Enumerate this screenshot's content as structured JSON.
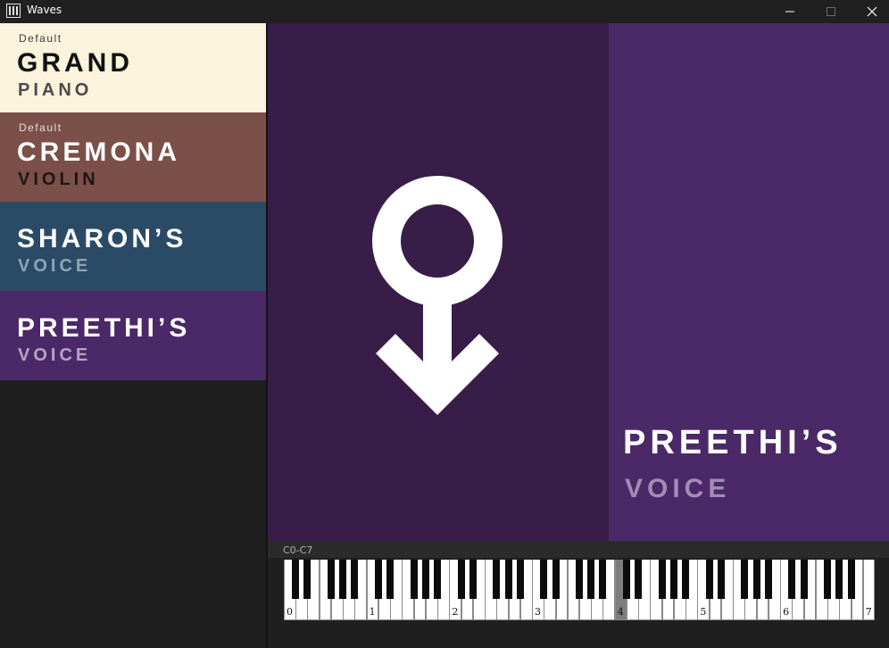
{
  "window": {
    "title": "Waves",
    "controls": [
      "minimize",
      "maximize",
      "close"
    ]
  },
  "sidebar": {
    "items": [
      {
        "tag": "Default",
        "line1": "GRAND",
        "line2": "PIANO",
        "bg": "#fbf3dc"
      },
      {
        "tag": "Default",
        "line1": "CREMONA",
        "line2": "VIOLIN",
        "bg": "#7a5049"
      },
      {
        "tag": "",
        "line1": "SHARON’S",
        "line2": "VOICE",
        "bg": "#2b4a65"
      },
      {
        "tag": "",
        "line1": "PREETHI’S",
        "line2": "VOICE",
        "bg": "#4b2868"
      }
    ]
  },
  "hero": {
    "title": "PREETHI’S",
    "subtitle": "VOICE",
    "icon": "gender-symbol-icon",
    "colors": {
      "left": "#371d48",
      "right": "#4b2868"
    }
  },
  "keyboard": {
    "range_label": "C0-C7",
    "octave_labels": [
      "0",
      "1",
      "2",
      "3",
      "4",
      "5",
      "6",
      "7"
    ],
    "active_octave": "4"
  }
}
